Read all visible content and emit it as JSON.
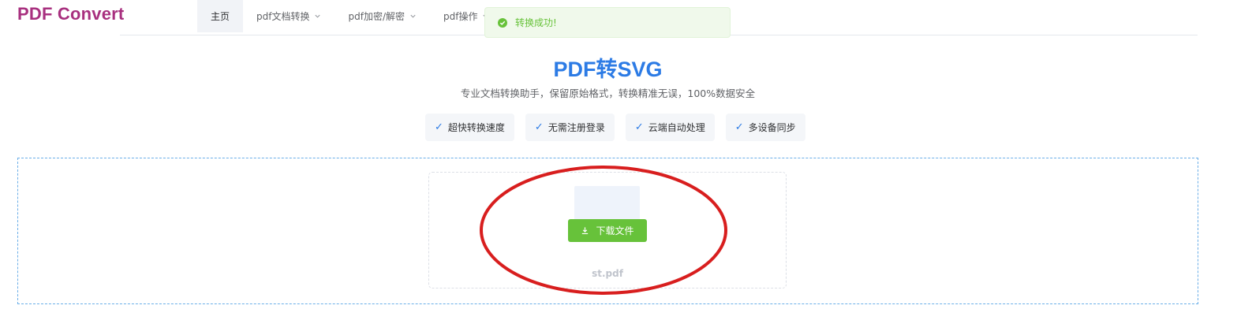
{
  "header": {
    "logo": "PDF Convert",
    "nav": [
      {
        "label": "主页",
        "active": true,
        "has_dropdown": false
      },
      {
        "label": "pdf文档转换",
        "active": false,
        "has_dropdown": true
      },
      {
        "label": "pdf加密/解密",
        "active": false,
        "has_dropdown": true
      },
      {
        "label": "pdf操作",
        "active": false,
        "has_dropdown": true
      }
    ]
  },
  "toast": {
    "message": "转换成功!",
    "icon": "check-circle-icon",
    "color": "#67c23a"
  },
  "hero": {
    "title": "PDF转SVG",
    "subtitle": "专业文档转换助手，保留原始格式，转换精准无误，100%数据安全",
    "features": [
      {
        "check": "✓",
        "label": "超快转换速度"
      },
      {
        "check": "✓",
        "label": "无需注册登录"
      },
      {
        "check": "✓",
        "label": "云端自动处理"
      },
      {
        "check": "✓",
        "label": "多设备同步"
      }
    ]
  },
  "upload": {
    "download_label": "下载文件",
    "download_icon": "download-icon",
    "file_name": "st.pdf"
  },
  "colors": {
    "brand": "#a8307f",
    "accent": "#2c7be5",
    "success": "#67c23a",
    "annotation": "#d81e1e"
  }
}
